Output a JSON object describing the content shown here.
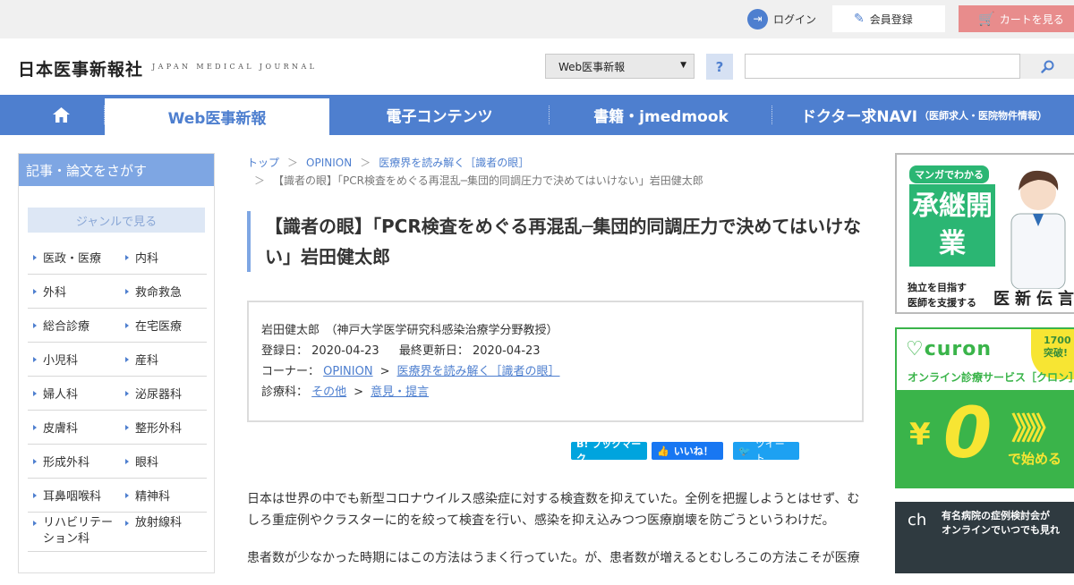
{
  "topbar": {
    "login_label": "ログイン",
    "register_label": "会員登録",
    "cart_label": "カートを見る"
  },
  "header": {
    "logo": "日本医事新報社",
    "logo_sub": "JAPAN MEDICAL JOURNAL",
    "site_select_value": "Web医事新報",
    "help_label": "?",
    "search_placeholder": ""
  },
  "nav": {
    "items": [
      {
        "label": "Web医事新報"
      },
      {
        "label": "電子コンテンツ"
      },
      {
        "label": "書籍・jmedmook"
      },
      {
        "label": "ドクター求NAVI",
        "sub": "（医師求人・医院物件情報）"
      }
    ]
  },
  "sidebar": {
    "title": "記事・論文をさがす",
    "genre_label": "ジャンルで見る",
    "genres": [
      [
        "医政・医療",
        "内科"
      ],
      [
        "外科",
        "救命救急"
      ],
      [
        "総合診療",
        "在宅医療"
      ],
      [
        "小児科",
        "産科"
      ],
      [
        "婦人科",
        "泌尿器科"
      ],
      [
        "皮膚科",
        "整形外科"
      ],
      [
        "形成外科",
        "眼科"
      ],
      [
        "耳鼻咽喉科",
        "精神科"
      ],
      [
        "リハビリテーション科",
        "放射線科"
      ]
    ]
  },
  "breadcrumb": {
    "items": [
      "トップ",
      "OPINION",
      "医療界を読み解く［識者の眼］"
    ],
    "current": "【識者の眼】「PCR検査をめぐる再混乱─集団的同調圧力で決めてはいけない」岩田健太郎"
  },
  "article": {
    "title": "【識者の眼】「PCR検査をめぐる再混乱─集団的同調圧力で決めてはいけない」岩田健太郎",
    "author": "岩田健太郎　（神戸大学医学研究科感染治療学分野教授）",
    "registered_label": "登録日：",
    "registered_date": "2020-04-23",
    "updated_label": "最終更新日：",
    "updated_date": "2020-04-23",
    "corner_label": "コーナー：",
    "corner_links": [
      "OPINION",
      "医療界を読み解く［識者の眼］"
    ],
    "field_label": "診療科：",
    "field_links": [
      "その他",
      "意見・提言"
    ],
    "paragraphs": [
      "日本は世界の中でも新型コロナウイルス感染症に対する検査数を抑えていた。全例を把握しようとはせず、むしろ重症例やクラスターに的を絞って検査を行い、感染を抑え込みつつ医療崩壊を防ごうというわけだ。",
      "患者数が少なかった時期にはこの方法はうまく行っていた。が、患者数が増えるとむしろこの方法こそが医療"
    ]
  },
  "social": {
    "hatena": "B! ブックマーク",
    "facebook": "いいね！",
    "twitter": "ツイート"
  },
  "ads": {
    "ad1": {
      "pill": "マンガでわかる",
      "big_text": "承継開業",
      "sub_line1": "独立を目指す",
      "sub_line2": "医師を支援する",
      "brand": "医新伝言"
    },
    "ad2": {
      "logo": "♡curon",
      "badge_line1": "1700",
      "badge_line2": "突破!",
      "service": "オンライン診療サービス［クロン］",
      "yen": "¥",
      "zero": "0",
      "chevrons": "》》》",
      "start": "で始める"
    },
    "ad3": {
      "logo": "ch",
      "line1": "有名病院の症例検討会が",
      "line2": "オンラインでいつでも見れ"
    }
  }
}
